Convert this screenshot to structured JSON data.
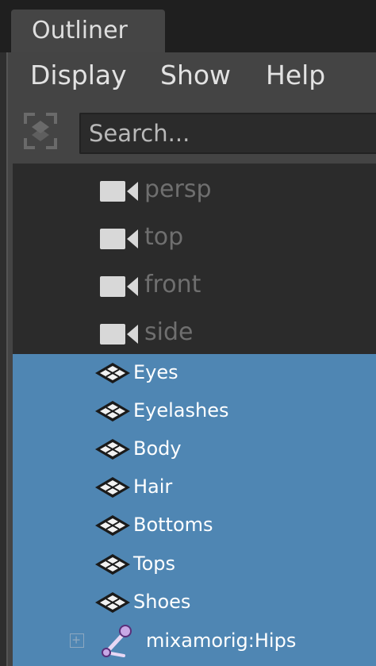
{
  "window": {
    "tab_label": "Outliner"
  },
  "menubar": {
    "items": [
      {
        "label": "Display"
      },
      {
        "label": "Show"
      },
      {
        "label": "Help"
      }
    ]
  },
  "search": {
    "placeholder": "Search...",
    "value": ""
  },
  "cameras": [
    {
      "label": "persp",
      "icon": "camera-icon"
    },
    {
      "label": "top",
      "icon": "camera-icon"
    },
    {
      "label": "front",
      "icon": "camera-icon"
    },
    {
      "label": "side",
      "icon": "camera-icon"
    }
  ],
  "meshes": [
    {
      "label": "Eyes",
      "icon": "mesh-icon"
    },
    {
      "label": "Eyelashes",
      "icon": "mesh-icon"
    },
    {
      "label": "Body",
      "icon": "mesh-icon"
    },
    {
      "label": "Hair",
      "icon": "mesh-icon"
    },
    {
      "label": "Bottoms",
      "icon": "mesh-icon"
    },
    {
      "label": "Tops",
      "icon": "mesh-icon"
    },
    {
      "label": "Shoes",
      "icon": "mesh-icon"
    }
  ],
  "joint_row": {
    "label": "mixamorig:Hips",
    "icon": "joint-icon",
    "expand_icon": "expand-plus-icon"
  },
  "colors": {
    "selection": "#4f86b3",
    "background": "#2b2b2b",
    "panel": "#444444",
    "dimmed_text": "#6f6f6f"
  }
}
